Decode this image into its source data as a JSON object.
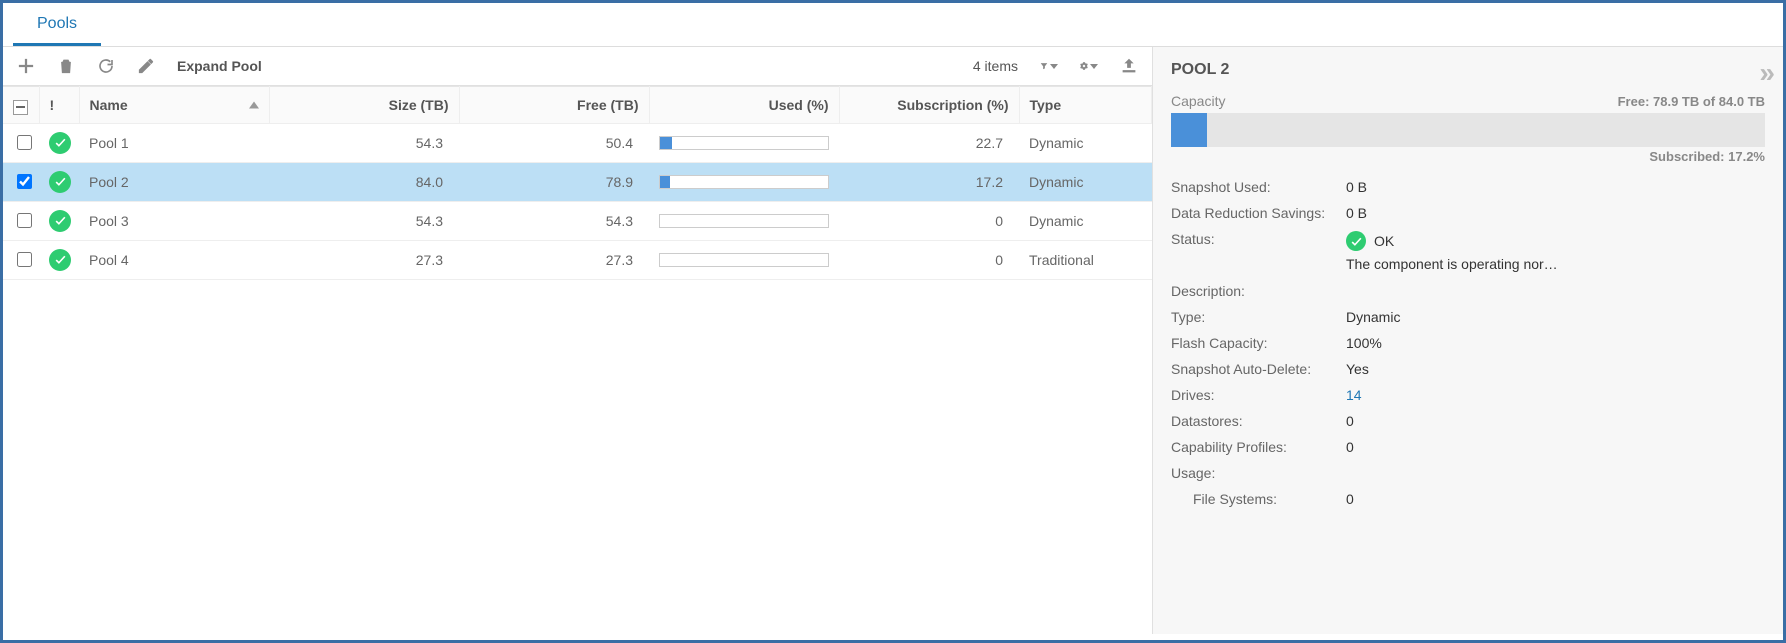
{
  "tab": {
    "label": "Pools"
  },
  "toolbar": {
    "expand_label": "Expand Pool",
    "items_count": "4 items"
  },
  "columns": {
    "name": "Name",
    "size": "Size (TB)",
    "free": "Free (TB)",
    "used": "Used (%)",
    "subscription": "Subscription (%)",
    "type": "Type",
    "status_header": "!"
  },
  "rows": [
    {
      "name": "Pool 1",
      "size": "54.3",
      "free": "50.4",
      "used_pct": 7.2,
      "sub": "22.7",
      "type": "Dynamic",
      "checked": false,
      "selected": false
    },
    {
      "name": "Pool 2",
      "size": "84.0",
      "free": "78.9",
      "used_pct": 6.1,
      "sub": "17.2",
      "type": "Dynamic",
      "checked": true,
      "selected": true
    },
    {
      "name": "Pool 3",
      "size": "54.3",
      "free": "54.3",
      "used_pct": 0,
      "sub": "0",
      "type": "Dynamic",
      "checked": false,
      "selected": false
    },
    {
      "name": "Pool 4",
      "size": "27.3",
      "free": "27.3",
      "used_pct": 0,
      "sub": "0",
      "type": "Traditional",
      "checked": false,
      "selected": false
    }
  ],
  "details": {
    "title": "POOL 2",
    "capacity_label": "Capacity",
    "free_text": "Free: 78.9 TB of 84.0 TB",
    "used_pct": 6.1,
    "subscribed_text": "Subscribed: 17.2%",
    "snapshot_used": {
      "label": "Snapshot Used:",
      "value": "0 B"
    },
    "data_reduction": {
      "label": "Data Reduction Savings:",
      "value": "0 B"
    },
    "status": {
      "label": "Status:",
      "text": "OK",
      "message": "The component is operating nor…"
    },
    "description": {
      "label": "Description:",
      "value": ""
    },
    "type": {
      "label": "Type:",
      "value": "Dynamic"
    },
    "flash": {
      "label": "Flash Capacity:",
      "value": "100%"
    },
    "auto_delete": {
      "label": "Snapshot Auto-Delete:",
      "value": "Yes"
    },
    "drives": {
      "label": "Drives:",
      "value": "14"
    },
    "datastores": {
      "label": "Datastores:",
      "value": "0"
    },
    "profiles": {
      "label": "Capability Profiles:",
      "value": "0"
    },
    "usage": {
      "label": "Usage:"
    },
    "filesystems": {
      "label": "File Systems:",
      "value": "0"
    }
  }
}
